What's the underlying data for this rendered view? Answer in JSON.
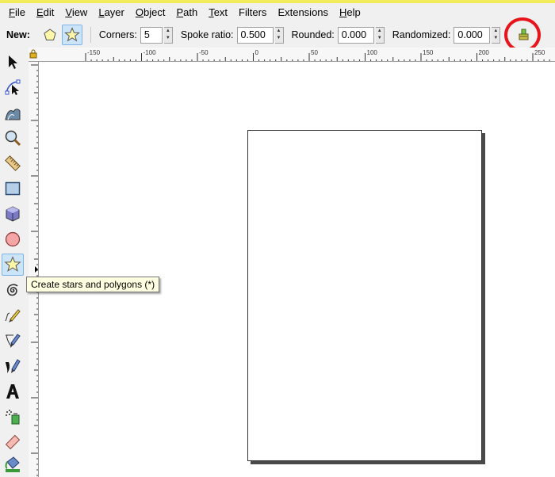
{
  "menu": {
    "items": [
      {
        "first": "F",
        "rest": "ile"
      },
      {
        "first": "E",
        "rest": "dit"
      },
      {
        "first": "V",
        "rest": "iew"
      },
      {
        "first": "L",
        "rest": "ayer"
      },
      {
        "first": "O",
        "rest": "bject"
      },
      {
        "first": "P",
        "rest": "ath"
      },
      {
        "first": "T",
        "rest": "ext"
      },
      {
        "first": "",
        "rest": "Filters"
      },
      {
        "first": "",
        "rest": "Extensions"
      },
      {
        "first": "H",
        "rest": "elp"
      }
    ]
  },
  "toolbar": {
    "new_label": "New:",
    "corners_label": "Corners:",
    "corners_value": "5",
    "spoke_label": "Spoke ratio:",
    "spoke_value": "0.500",
    "rounded_label": "Rounded:",
    "rounded_value": "0.000",
    "randomized_label": "Randomized:",
    "randomized_value": "0.000"
  },
  "ruler": {
    "labels": [
      "-150",
      "-100",
      "-50",
      "0",
      "50",
      "100",
      "150",
      "200",
      "250"
    ]
  },
  "tooltip": {
    "text": "Create stars and polygons (*)"
  },
  "colors": {
    "accent_highlight": "#cce4f7",
    "annotation_circle": "#e8141c",
    "tooltip_bg": "#ffffe1"
  },
  "tools": [
    "selector-icon",
    "node-icon",
    "tweak-icon",
    "zoom-icon",
    "measure-icon",
    "rectangle-icon",
    "3d-box-icon",
    "ellipse-icon",
    "star-icon",
    "spiral-icon",
    "pencil-icon",
    "pen-icon",
    "calligraphy-icon",
    "text-icon",
    "spray-icon",
    "eraser-icon",
    "paint-bucket-icon"
  ]
}
